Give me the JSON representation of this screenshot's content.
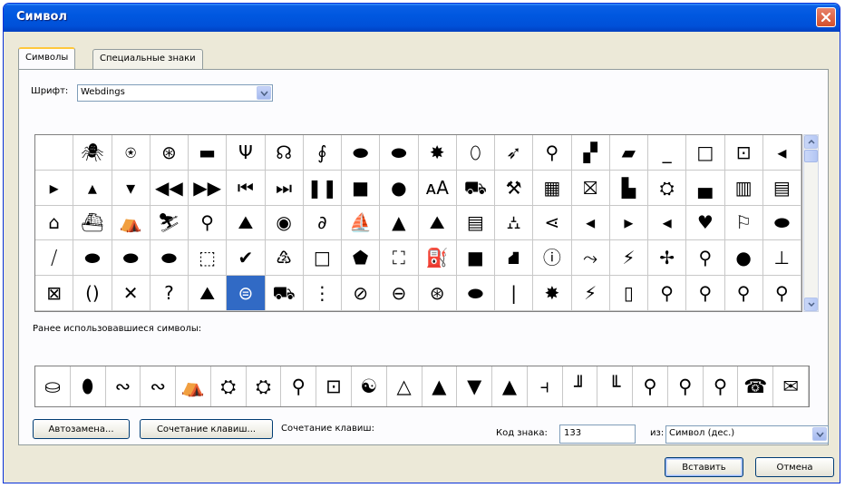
{
  "window": {
    "title": "Символ"
  },
  "tabs": [
    {
      "label": "Символы",
      "active": true
    },
    {
      "label": "Специальные знаки",
      "active": false
    }
  ],
  "font": {
    "label": "Шрифт:",
    "value": "Webdings"
  },
  "symbol_grid": {
    "selected_index": 85,
    "cells": [
      " ",
      "🕷",
      "⍟",
      "⊛",
      "▬",
      "Ψ",
      "☊",
      "∮",
      "⬬",
      "⬬",
      "✸",
      "⬯",
      "➶",
      "⚲",
      "▞",
      "▰",
      "_",
      "□",
      "⊡",
      "◂",
      "▸",
      "▴",
      "▾",
      "◀◀",
      "▶▶",
      "⏮",
      "⏭",
      "❚❚",
      "■",
      "●",
      "ᴀA",
      "⛟",
      "⚒",
      "▦",
      "⛝",
      "▙",
      "⛭",
      "▄",
      "▥",
      "▤",
      "⌂",
      "⛴",
      "⛺",
      "⛷",
      "⚲",
      "⛰",
      "◉",
      "∂",
      "⛵",
      "▲",
      "⛰",
      "▤",
      "⛼",
      "⋖",
      "◂",
      "▸",
      "◂",
      "♥",
      "⚐",
      "⬬",
      "⧸",
      "⬬",
      "⬬",
      "⬬",
      "⬚",
      "✔",
      "♴",
      "□",
      "⬟",
      "⛶",
      "⛽",
      "■",
      "⛘",
      "ⓘ",
      "⤳",
      "⚡",
      "✢",
      "⚲",
      "●",
      "⊥",
      "⊠",
      "()",
      "✕",
      "?",
      "⛰",
      "⊜",
      "⛟",
      "⋮",
      "⊘",
      "⊖",
      "⊛",
      "⬬",
      "|",
      "✸",
      "⚡",
      "▯",
      "⚲",
      "⚲",
      "⚲",
      "⚲",
      "⊘",
      "⚲",
      "⍑",
      "☡",
      "⛹",
      "⌷",
      "⛰",
      "⛷",
      "⛷",
      "▭",
      "⛟",
      "☰",
      "⛁",
      "⌂",
      "⊏",
      "⊟",
      "⫶",
      "⚲",
      "◡",
      "⛷"
    ]
  },
  "recent": {
    "label": "Ранее использовавшиеся символы:",
    "symbols": [
      "⛀",
      "⬮",
      "∾",
      "∾",
      "⛺",
      "⛭",
      "⛭",
      "⚲",
      "⊡",
      "☯",
      "△",
      "▲",
      "▼",
      "▲",
      "⫞",
      "╜",
      "╙",
      "⚲",
      "⚲",
      "⚲",
      "☎",
      "✉",
      "✓"
    ]
  },
  "code": {
    "label": "Код знака:",
    "value": "133",
    "from_label": "из:",
    "from_value": "Символ (дес.)"
  },
  "buttons": {
    "autocorrect": "Автозамена...",
    "shortcut_key": "Сочетание клавиш...",
    "shortcut_label": "Сочетание клавиш:",
    "insert": "Вставить",
    "cancel": "Отмена"
  }
}
